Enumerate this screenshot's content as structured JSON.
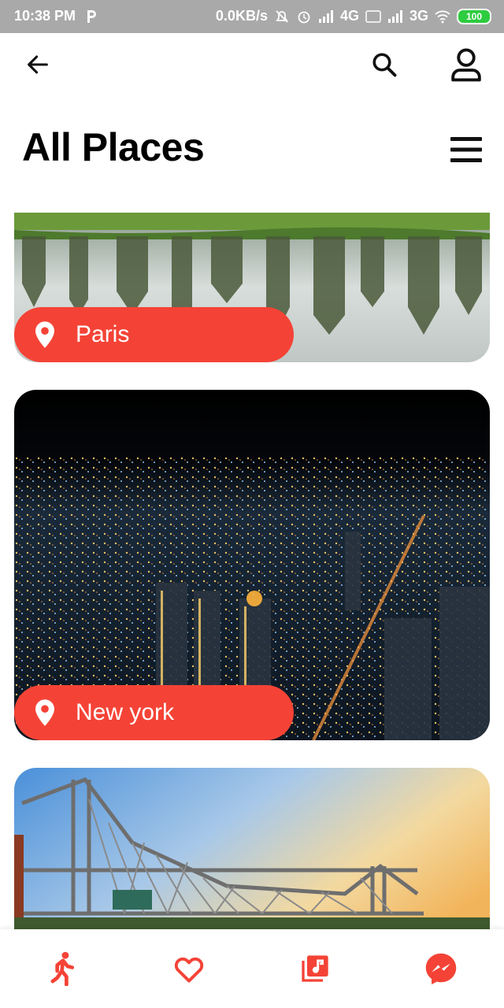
{
  "status_bar": {
    "time": "10:38 PM",
    "speed": "0.0KB/s",
    "network_1": "4G",
    "network_2": "3G",
    "battery": "100"
  },
  "icons": {
    "back": "arrow-left-icon",
    "search": "search-icon",
    "profile": "user-icon",
    "menu": "hamburger-menu-icon",
    "pin": "location-pin-icon",
    "nav": [
      "walking-person-icon",
      "heart-icon",
      "music-library-icon",
      "messenger-icon"
    ]
  },
  "header": {
    "title": "All Places"
  },
  "places": [
    {
      "name": "Paris"
    },
    {
      "name": "New york"
    },
    {
      "name": ""
    }
  ],
  "colors": {
    "accent": "#f44336",
    "status_bar": "#a9a9a9",
    "battery": "#2ecc40"
  }
}
